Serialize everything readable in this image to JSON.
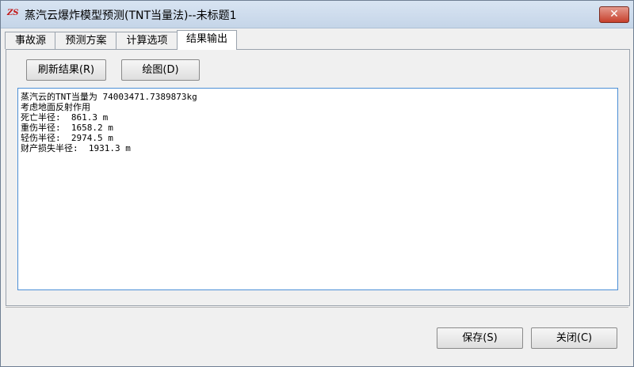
{
  "window": {
    "title": "蒸汽云爆炸模型预测(TNT当量法)--未标题1",
    "icon_text": "ZS",
    "close_symbol": "✕"
  },
  "tabs": [
    {
      "label": "事故源"
    },
    {
      "label": "预测方案"
    },
    {
      "label": "计算选项"
    },
    {
      "label": "结果输出"
    }
  ],
  "toolbar": {
    "refresh_label": "刷新结果(R)",
    "plot_label": "绘图(D)"
  },
  "results": {
    "lines": [
      "蒸汽云的TNT当量为 74003471.7389873kg",
      "考虑地面反射作用",
      "死亡半径:  861.3 m",
      "重伤半径:  1658.2 m",
      "轻伤半径:  2974.5 m",
      "财产损失半径:  1931.3 m"
    ]
  },
  "footer": {
    "save_label": "保存(S)",
    "close_label": "关闭(C)"
  },
  "colors": {
    "accent_border": "#4c8fd6",
    "close_button": "#c7402c"
  }
}
